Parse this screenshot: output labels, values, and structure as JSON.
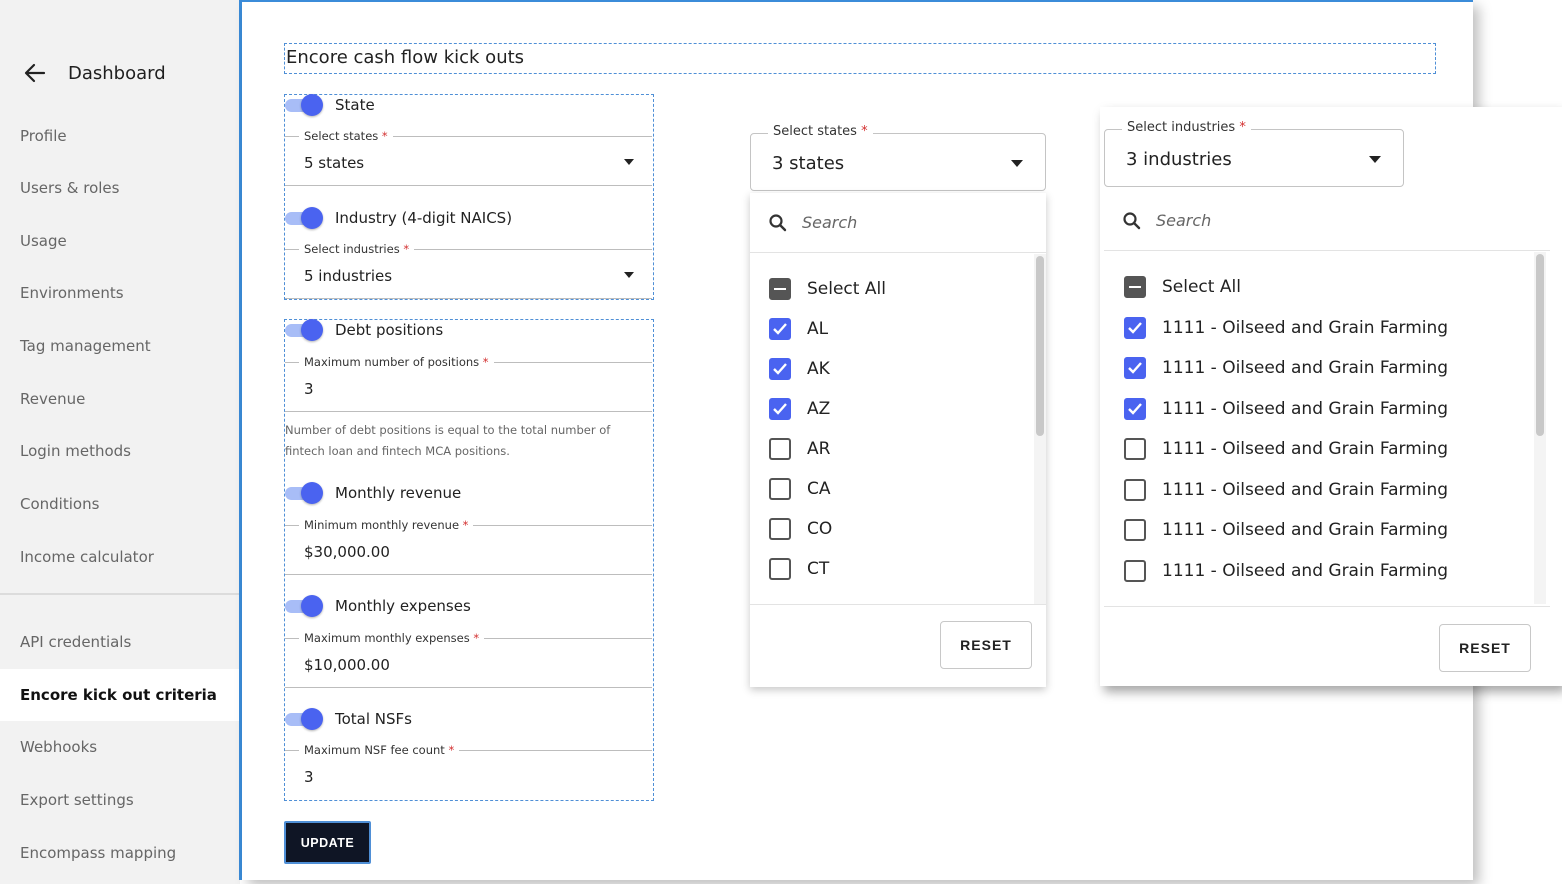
{
  "sidebar": {
    "back_label": "Dashboard",
    "items": [
      {
        "label": "Profile"
      },
      {
        "label": "Users & roles"
      },
      {
        "label": "Usage"
      },
      {
        "label": "Environments"
      },
      {
        "label": "Tag management"
      },
      {
        "label": "Revenue"
      },
      {
        "label": "Login methods"
      },
      {
        "label": "Conditions"
      },
      {
        "label": "Income calculator"
      },
      {
        "label": "API credentials"
      },
      {
        "label": "Encore kick out criteria",
        "active": true
      },
      {
        "label": "Webhooks"
      },
      {
        "label": "Export settings"
      },
      {
        "label": "Encompass mapping"
      }
    ]
  },
  "main": {
    "title": "Encore cash flow kick outs",
    "state": {
      "toggle_label": "State",
      "enabled": true,
      "field_label": "Select states",
      "value": "5 states"
    },
    "industry": {
      "toggle_label": "Industry (4-digit NAICS)",
      "enabled": true,
      "field_label": "Select industries",
      "value": "5 industries"
    },
    "debt": {
      "toggle_label": "Debt positions",
      "enabled": true,
      "field_label": "Maximum number of positions",
      "value": "3",
      "helper": "Number of debt positions is equal to the total number of fintech loan and fintech MCA positions."
    },
    "revenue": {
      "toggle_label": "Monthly revenue",
      "enabled": true,
      "field_label": "Minimum monthly revenue",
      "value": "$30,000.00"
    },
    "expenses": {
      "toggle_label": "Monthly expenses",
      "enabled": true,
      "field_label": "Maximum monthly expenses",
      "value": "$10,000.00"
    },
    "nsf": {
      "toggle_label": "Total NSFs",
      "enabled": true,
      "field_label": "Maximum NSF fee count",
      "value": "3"
    },
    "update_label": "UPDATE",
    "required_mark": "*"
  },
  "states_dropdown": {
    "label": "Select states",
    "value": "3 states",
    "search_placeholder": "Search",
    "select_all_label": "Select All",
    "options": [
      {
        "label": "AL",
        "checked": true
      },
      {
        "label": "AK",
        "checked": true
      },
      {
        "label": "AZ",
        "checked": true
      },
      {
        "label": "AR",
        "checked": false
      },
      {
        "label": "CA",
        "checked": false
      },
      {
        "label": "CO",
        "checked": false
      },
      {
        "label": "CT",
        "checked": false
      }
    ],
    "reset_label": "RESET"
  },
  "industries_dropdown": {
    "label": "Select industries",
    "value": "3 industries",
    "search_placeholder": "Search",
    "select_all_label": "Select All",
    "options": [
      {
        "label": "1111 - Oilseed and Grain Farming",
        "checked": true
      },
      {
        "label": "1111 - Oilseed and Grain Farming",
        "checked": true
      },
      {
        "label": "1111 - Oilseed and Grain Farming",
        "checked": true
      },
      {
        "label": "1111 - Oilseed and Grain Farming",
        "checked": false
      },
      {
        "label": "1111 - Oilseed and Grain Farming",
        "checked": false
      },
      {
        "label": "1111 - Oilseed and Grain Farming",
        "checked": false
      },
      {
        "label": "1111 - Oilseed and Grain Farming",
        "checked": false
      }
    ],
    "reset_label": "RESET"
  },
  "colors": {
    "accent": "#4a63f0",
    "focus_border": "#3b8cd9",
    "button_dark": "#0f1525",
    "required": "#d32f2f"
  },
  "icons": {
    "back": "arrow-left-icon",
    "search": "search-icon",
    "dropdown": "caret-down-icon",
    "checkbox_checked": "check-icon"
  }
}
